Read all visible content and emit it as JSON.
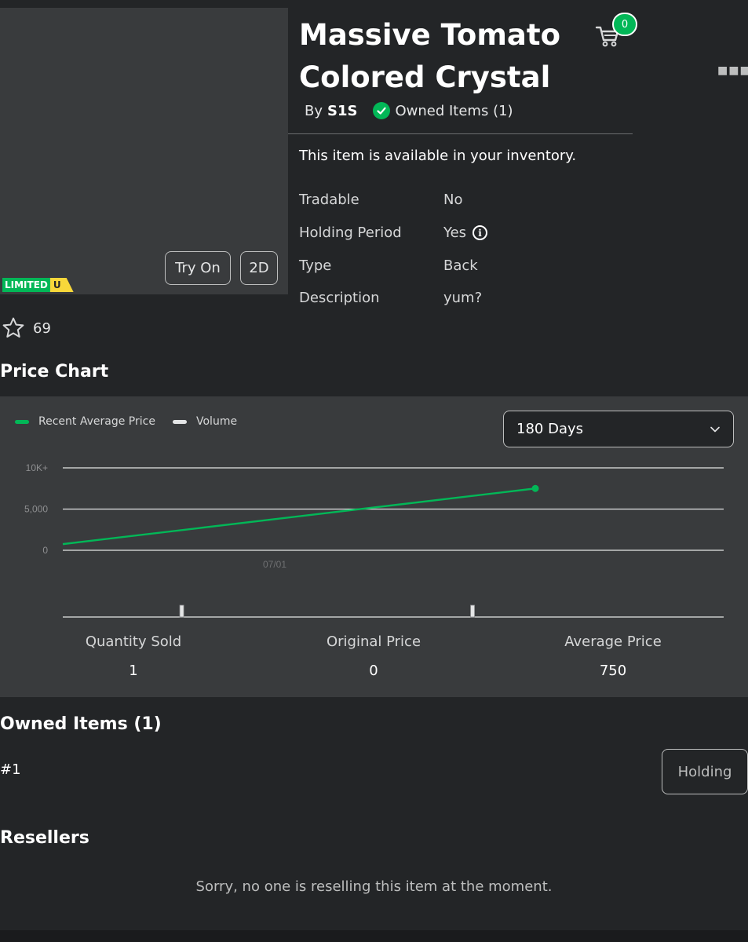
{
  "item": {
    "title_line1": "Massive Tomato",
    "title_line2": "Colored Crystal",
    "by_label": "By",
    "creator": "S1S",
    "owned_label": "Owned Items (1)",
    "availability": "This item is available in your inventory.",
    "limited_label": "LIMITED",
    "limited_u": "U",
    "favorites": "69"
  },
  "thumbnail": {
    "try_on_label": "Try On",
    "view_2d_label": "2D"
  },
  "header": {
    "cart_count": "0",
    "more_icon": "more-dots-icon"
  },
  "details": [
    {
      "label": "Tradable",
      "value": "No"
    },
    {
      "label": "Holding Period",
      "value": "Yes"
    },
    {
      "label": "Type",
      "value": "Back"
    },
    {
      "label": "Description",
      "value": "yum?"
    }
  ],
  "price_chart": {
    "section_title": "Price Chart",
    "period_selected": "180 Days",
    "legend_price": "Recent Average Price",
    "legend_volume": "Volume",
    "colors": {
      "price": "#02b757",
      "volume": "#e4e5e6"
    }
  },
  "chart_data": {
    "type": "line",
    "y_ticks": [
      "0",
      "5,000",
      "10K+"
    ],
    "ylim": [
      0,
      10000
    ],
    "x_tick_label": "07/01",
    "series": [
      {
        "name": "Recent Average Price",
        "points": [
          [
            0.0,
            750
          ],
          [
            0.715,
            7500
          ]
        ]
      }
    ],
    "volume_bars": [
      0.18,
      0.62
    ]
  },
  "stats": [
    {
      "label": "Quantity Sold",
      "value": "1"
    },
    {
      "label": "Original Price",
      "value": "0"
    },
    {
      "label": "Average Price",
      "value": "750"
    }
  ],
  "owned": {
    "section_title": "Owned Items (1)",
    "serial": "#1",
    "holding_label": "Holding"
  },
  "resellers": {
    "section_title": "Resellers",
    "empty_message": "Sorry, no one is reselling this item at the moment."
  }
}
